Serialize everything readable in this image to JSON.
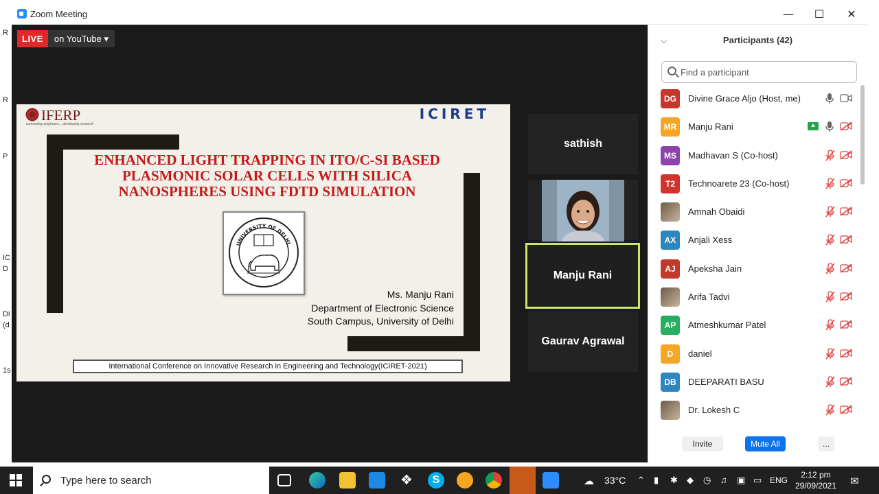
{
  "window": {
    "title": "Zoom Meeting"
  },
  "desktop_fragments": [
    "R",
    "R",
    "P",
    "IC",
    "D",
    "Di",
    "(d",
    "1s"
  ],
  "live": {
    "badge": "LIVE",
    "target": "on YouTube ▾"
  },
  "slide": {
    "logo_text": "IFERP",
    "logo_sub": "connecting engineers... developing research",
    "brand": "ICIRET",
    "title_lines": [
      "ENHANCED LIGHT TRAPPING IN ITO/C-SI BASED",
      "PLASMONIC SOLAR CELLS WITH SILICA",
      "NANOSPHERES USING FDTD SIMULATION"
    ],
    "seal_name": "UNIVERSITY OF DELHI",
    "presenter_lines": [
      "Ms. Manju Rani",
      "Department of Electronic Science",
      "South Campus, University of Delhi"
    ],
    "conference": "International Conference on Innovative Research in Engineering and Technology(ICIRET-2021)"
  },
  "video_tiles": [
    {
      "name": "sathish",
      "active": false
    },
    {
      "name": "",
      "active": false,
      "photo": true
    },
    {
      "name": "Manju Rani",
      "active": true
    },
    {
      "name": "Gaurav Agrawal",
      "active": false
    }
  ],
  "participants": {
    "title": "Participants (42)",
    "search_placeholder": "Find a participant",
    "list": [
      {
        "initials": "DG",
        "color": "#C8372D",
        "name": "Divine Grace Aljo (Host, me)",
        "mic": "on",
        "cam": "on"
      },
      {
        "initials": "MR",
        "color": "#F5A623",
        "name": "Manju Rani",
        "mic": "on",
        "cam": "off",
        "sharing": true
      },
      {
        "initials": "MS",
        "color": "#8E44AD",
        "name": "Madhavan S (Co-host)",
        "mic": "off",
        "cam": "off"
      },
      {
        "initials": "T2",
        "color": "#D0342C",
        "name": "Technoarete 23 (Co-host)",
        "mic": "off",
        "cam": "off"
      },
      {
        "initials": "",
        "color": "",
        "name": "Amnah Obaidi",
        "mic": "off",
        "cam": "off",
        "photo": true
      },
      {
        "initials": "AX",
        "color": "#2E86C1",
        "name": "Anjali Xess",
        "mic": "off",
        "cam": "off"
      },
      {
        "initials": "AJ",
        "color": "#C0392B",
        "name": "Apeksha Jain",
        "mic": "off",
        "cam": "off"
      },
      {
        "initials": "",
        "color": "",
        "name": "Arifa Tadvi",
        "mic": "off",
        "cam": "off",
        "photo": true
      },
      {
        "initials": "AP",
        "color": "#27AE60",
        "name": "Atmeshkumar Patel",
        "mic": "off",
        "cam": "off"
      },
      {
        "initials": "D",
        "color": "#F5A623",
        "name": "daniel",
        "mic": "off",
        "cam": "off"
      },
      {
        "initials": "DB",
        "color": "#2E86C1",
        "name": "DEEPARATI BASU",
        "mic": "off",
        "cam": "off"
      },
      {
        "initials": "",
        "color": "",
        "name": "Dr. Lokesh C",
        "mic": "off",
        "cam": "off",
        "photo": true
      }
    ],
    "buttons": {
      "invite": "Invite",
      "mute_all": "Mute All",
      "more": "..."
    }
  },
  "taskbar": {
    "search_text": "Type here to search",
    "weather": "33°C",
    "language": "ENG",
    "time": "2:12 pm",
    "date": "29/09/2021"
  }
}
